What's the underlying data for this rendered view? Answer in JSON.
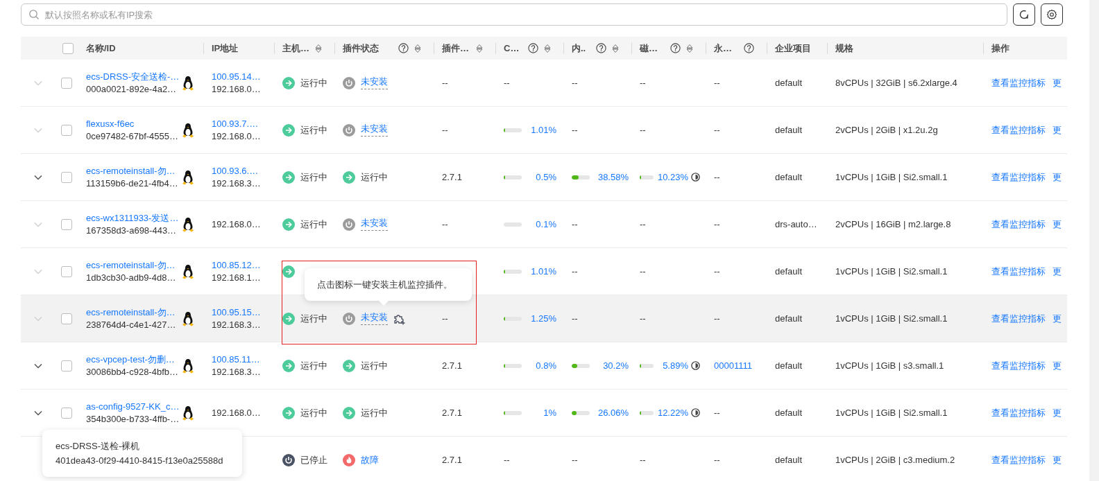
{
  "search": {
    "placeholder": "默认按照名称或私有IP搜索"
  },
  "table": {
    "select_all": {
      "checked": false
    },
    "columns": [
      {
        "label": "名称/ID",
        "help": false,
        "sortable": false
      },
      {
        "label": "IP地址",
        "help": false,
        "sortable": false
      },
      {
        "label": "主机…",
        "help": false,
        "sortable": true
      },
      {
        "label": "插件状态",
        "help": true,
        "sortable": true
      },
      {
        "label": "插件…",
        "help": false,
        "sortable": true
      },
      {
        "label": "C…",
        "help": true,
        "sortable": true
      },
      {
        "label": "内..",
        "help": true,
        "sortable": true
      },
      {
        "label": "磁…",
        "help": true,
        "sortable": true
      },
      {
        "label": "永…",
        "help": true,
        "sortable": false
      },
      {
        "label": "企业项目",
        "help": false,
        "sortable": false
      },
      {
        "label": "规格",
        "help": false,
        "sortable": false
      },
      {
        "label": "操作",
        "help": false,
        "sortable": false
      }
    ],
    "rows": [
      {
        "expandable": false,
        "checked": false,
        "hovered": false,
        "name": "ecs-DRSS-安全送检-…",
        "id": "000a0021-892e-4a2…",
        "ip_public": "100.95.14…",
        "ip_private": "192.168.0…",
        "host_status": {
          "kind": "running",
          "label": "运行中"
        },
        "plugin_status": {
          "kind": "not_installed",
          "label": "未安装",
          "install_icon": false
        },
        "plugin_version": "--",
        "cpu": {
          "kind": "empty",
          "text": "--"
        },
        "memory": {
          "kind": "empty",
          "text": "--"
        },
        "disk": {
          "kind": "empty",
          "text": "--"
        },
        "column_9": {
          "kind": "plain",
          "text": "--"
        },
        "project": "default",
        "spec": "8vCPUs | 32GiB | s6.2xlarge.4",
        "actions": [
          "查看监控指标",
          "更"
        ]
      },
      {
        "expandable": false,
        "checked": false,
        "hovered": false,
        "name": "flexusx-f6ec",
        "id": "0ce97482-67bf-4555…",
        "ip_public": "100.93.7.…",
        "ip_private": "192.168.0…",
        "host_status": {
          "kind": "running",
          "label": "运行中"
        },
        "plugin_status": {
          "kind": "not_installed",
          "label": "未安装",
          "install_icon": false
        },
        "plugin_version": "--",
        "cpu": {
          "kind": "meter",
          "level": 0.0101,
          "reading": "1.01%"
        },
        "memory": {
          "kind": "empty",
          "text": "--"
        },
        "disk": {
          "kind": "empty",
          "text": "--"
        },
        "column_9": {
          "kind": "plain",
          "text": "--"
        },
        "project": "default",
        "spec": "2vCPUs | 2GiB | x1.2u.2g",
        "actions": [
          "查看监控指标",
          "更"
        ]
      },
      {
        "expandable": true,
        "checked": false,
        "hovered": false,
        "name": "ecs-remoteinstall-勿…",
        "id": "113159b6-de21-4fb4…",
        "ip_public": "100.93.6.…",
        "ip_private": "192.168.3…",
        "host_status": {
          "kind": "running",
          "label": "运行中"
        },
        "plugin_status": {
          "kind": "running",
          "label": "运行中",
          "install_icon": false
        },
        "plugin_version": "2.7.1",
        "cpu": {
          "kind": "meter",
          "level": 0.005,
          "reading": "0.5%"
        },
        "memory": {
          "kind": "meter",
          "level": 0.3858,
          "reading": "38.58%"
        },
        "disk": {
          "kind": "meter",
          "level": 0.1023,
          "reading": "10.23%"
        },
        "column_9": {
          "kind": "plain",
          "text": "--"
        },
        "project": "default",
        "spec": "1vCPUs | 1GiB | Si2.small.1",
        "actions": [
          "查看监控指标",
          "更"
        ]
      },
      {
        "expandable": false,
        "checked": false,
        "hovered": false,
        "name": "ecs-wx1311933-发送…",
        "id": "167358d3-a698-443…",
        "ip_private": "192.168.0…",
        "host_status": {
          "kind": "running",
          "label": "运行中"
        },
        "plugin_status": {
          "kind": "not_installed",
          "label": "未安装",
          "install_icon": false
        },
        "plugin_version": "--",
        "cpu": {
          "kind": "meter",
          "level": 0.001,
          "reading": "0.1%"
        },
        "memory": {
          "kind": "empty",
          "text": "--"
        },
        "disk": {
          "kind": "empty",
          "text": "--"
        },
        "column_9": {
          "kind": "plain",
          "text": "--"
        },
        "project": "drs-auto…",
        "spec": "2vCPUs | 16GiB | m2.large.8",
        "actions": [
          "查看监控指标",
          "更"
        ]
      },
      {
        "expandable": false,
        "checked": false,
        "hovered": false,
        "name": "ecs-remoteinstall-勿…",
        "id": "1db3cb30-adb9-4d8…",
        "ip_public": "100.85.12…",
        "ip_private": "192.168.1…",
        "host_status": {
          "kind": "running"
        },
        "cpu": {
          "kind": "meter",
          "level": 0.0101,
          "reading": "1.01%"
        },
        "memory": {
          "kind": "empty",
          "text": "--"
        },
        "disk": {
          "kind": "empty",
          "text": "--"
        },
        "column_9": {
          "kind": "plain",
          "text": "--"
        },
        "project": "default",
        "spec": "1vCPUs | 1GiB | Si2.small.1",
        "actions": [
          "查看监控指标",
          "更"
        ]
      },
      {
        "expandable": false,
        "checked": false,
        "hovered": true,
        "name": "ecs-remoteinstall-勿…",
        "id": "238764d4-c4e1-427…",
        "ip_public": "100.95.15…",
        "ip_private": "192.168.3…",
        "host_status": {
          "kind": "running",
          "label": "运行中"
        },
        "plugin_status": {
          "kind": "not_installed",
          "label": "未安装",
          "install_icon": true
        },
        "plugin_version": "--",
        "cpu": {
          "kind": "meter",
          "level": 0.0125,
          "reading": "1.25%"
        },
        "memory": {
          "kind": "empty",
          "text": "--"
        },
        "disk": {
          "kind": "empty",
          "text": "--"
        },
        "column_9": {
          "kind": "plain",
          "text": "--"
        },
        "project": "default",
        "spec": "1vCPUs | 1GiB | Si2.small.1",
        "actions": [
          "查看监控指标",
          "更"
        ]
      },
      {
        "expandable": true,
        "checked": false,
        "hovered": false,
        "name": "ecs-vpcep-test-勿删…",
        "id": "30086bb4-c928-4bfb…",
        "ip_public": "100.85.11…",
        "ip_private": "192.168.3…",
        "host_status": {
          "kind": "running",
          "label": "运行中"
        },
        "plugin_status": {
          "kind": "running",
          "label": "运行中",
          "install_icon": false
        },
        "plugin_version": "2.7.1",
        "cpu": {
          "kind": "meter",
          "level": 0.008,
          "reading": "0.8%"
        },
        "memory": {
          "kind": "meter",
          "level": 0.302,
          "reading": "30.2%"
        },
        "disk": {
          "kind": "meter",
          "level": 0.0589,
          "reading": "5.89%"
        },
        "column_9": {
          "kind": "link",
          "text": "00001111"
        },
        "project": "default",
        "spec": "1vCPUs | 1GiB | s3.small.1",
        "actions": [
          "查看监控指标",
          "更"
        ]
      },
      {
        "expandable": true,
        "checked": false,
        "hovered": false,
        "name": "as-config-9527-KK_c…",
        "id": "354b300e-b733-4ffb-…",
        "ip_private": "192.168.0…",
        "host_status": {
          "kind": "running",
          "label": "运行中"
        },
        "plugin_status": {
          "kind": "running",
          "label": "运行中",
          "install_icon": false
        },
        "plugin_version": "2.7.1",
        "cpu": {
          "kind": "meter",
          "level": 0.01,
          "reading": "1%"
        },
        "memory": {
          "kind": "meter",
          "level": 0.2606,
          "reading": "26.06%"
        },
        "disk": {
          "kind": "meter",
          "level": 0.1222,
          "reading": "12.22%"
        },
        "column_9": {
          "kind": "plain",
          "text": "--"
        },
        "project": "default",
        "spec": "1vCPUs | 1GiB | Si2.small.1",
        "actions": [
          "查看监控指标",
          "更"
        ]
      },
      {
        "hovered": false,
        "host_status": {
          "kind": "stopped",
          "label": "已停止"
        },
        "plugin_status": {
          "kind": "fault",
          "label": "故障",
          "install_icon": false
        },
        "plugin_version": "2.7.1",
        "cpu": {
          "kind": "empty",
          "text": "--"
        },
        "memory": {
          "kind": "empty",
          "text": "--"
        },
        "disk": {
          "kind": "empty",
          "text": "--"
        },
        "column_9": {
          "kind": "plain",
          "text": "--"
        },
        "project": "default",
        "spec": "1vCPUs | 2GiB | c3.medium.2",
        "actions": [
          "查看监控指标",
          "更"
        ]
      }
    ]
  },
  "install_tooltip": {
    "text": "点击图标一键安装主机监控插件。"
  },
  "name_tooltip": {
    "name": "ecs-DRSS-送检-裸机",
    "id": "401dea43-0f29-4410-8415-f13e0a25588d"
  }
}
